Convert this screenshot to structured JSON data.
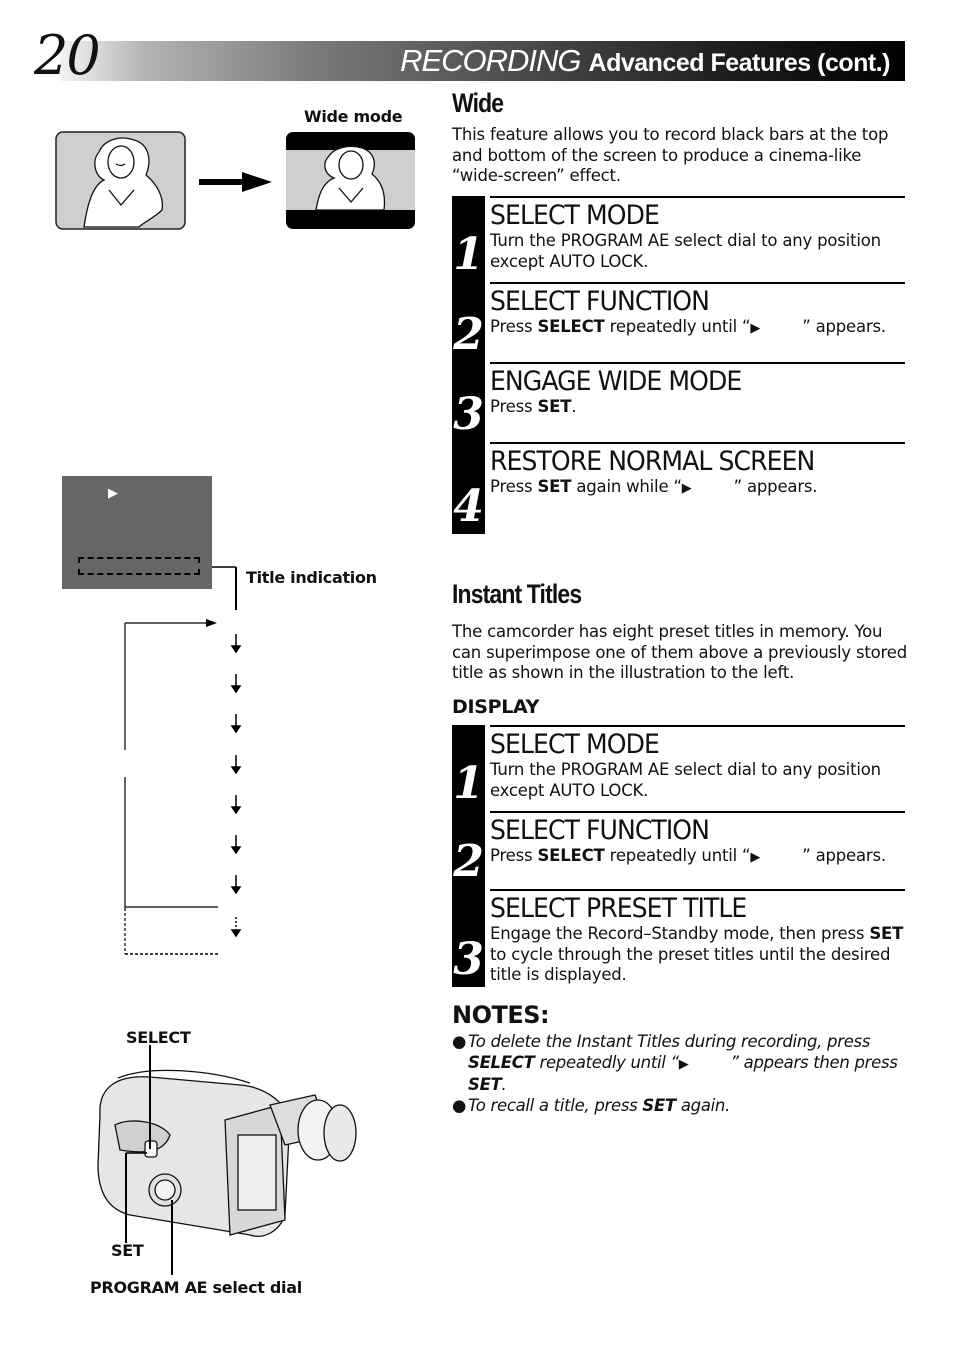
{
  "header": {
    "page_number": "20",
    "title_main": "RECORDING",
    "title_sub": "Advanced Features (cont.)"
  },
  "wide_illustration": {
    "label": "Wide mode"
  },
  "wide": {
    "heading": "Wide",
    "intro": "This feature allows you to record black bars at the top and bottom of the screen to produce a cinema-like “wide-screen” effect.",
    "steps": [
      {
        "number": "1",
        "title": "SELECT MODE",
        "body": "Turn the PROGRAM AE select dial to any position except AUTO LOCK."
      },
      {
        "number": "2",
        "title": "SELECT FUNCTION",
        "pre": "Press ",
        "bold": "SELECT",
        "mid": " repeatedly until “",
        "icon": "▶",
        "post": "” appears."
      },
      {
        "number": "3",
        "title": "ENGAGE WIDE MODE",
        "pre": "Press ",
        "bold": "SET",
        "post": "."
      },
      {
        "number": "4",
        "title": "RESTORE NORMAL SCREEN",
        "pre": "Press ",
        "bold": "SET",
        "mid": " again while “",
        "icon": "▶",
        "post": "” appears."
      }
    ]
  },
  "title_illustration": {
    "label": "Title indication",
    "screen_icon": "▶"
  },
  "instant_titles": {
    "heading": "Instant Titles",
    "intro": "The camcorder has eight preset titles in memory. You can superimpose one of them above a previously stored title as shown in the illustration to the left.",
    "subheading": "DISPLAY",
    "steps": [
      {
        "number": "1",
        "title": "SELECT MODE",
        "body": "Turn the PROGRAM AE select dial to any position except AUTO LOCK."
      },
      {
        "number": "2",
        "title": "SELECT FUNCTION",
        "pre": "Press ",
        "bold": "SELECT",
        "mid": " repeatedly until “",
        "icon": "▶",
        "post": "” appears."
      },
      {
        "number": "3",
        "title": "SELECT PRESET TITLE",
        "pre": "Engage the Record–Standby mode, then press ",
        "bold": "SET",
        "post": " to cycle through the preset titles until the desired title is displayed."
      }
    ]
  },
  "notes": {
    "title": "NOTES:",
    "items": [
      {
        "pre": "To delete the Instant Titles during recording, press ",
        "bold": "SELECT",
        "mid": " repeatedly until “",
        "icon": "▶",
        "mid2": "” appears then press ",
        "bold2": "SET",
        "post": "."
      },
      {
        "pre": "To recall a title, press ",
        "bold": "SET",
        "post": " again."
      }
    ]
  },
  "camera_illustration": {
    "label_select": "SELECT",
    "label_set": "SET",
    "label_dial": "PROGRAM AE select dial"
  }
}
